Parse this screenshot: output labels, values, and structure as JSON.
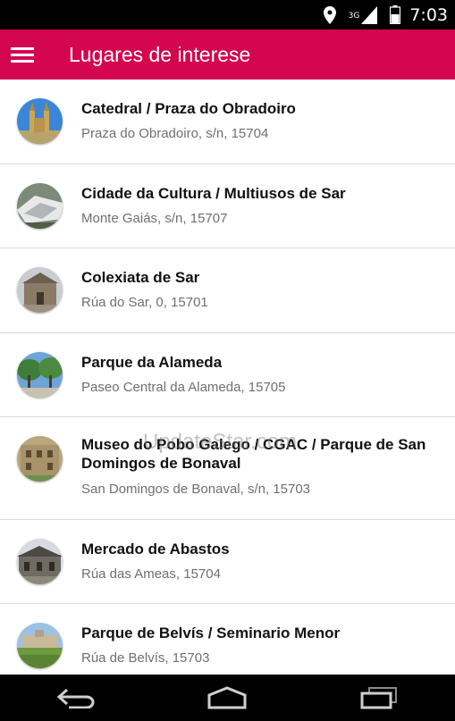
{
  "status_bar": {
    "network": "3G",
    "time": "7:03",
    "icons": [
      "location-icon",
      "signal-icon",
      "battery-icon"
    ]
  },
  "app_bar": {
    "title": "Lugares de interese",
    "menu_icon": "hamburger-menu-icon",
    "background": "#d3064f"
  },
  "places": [
    {
      "name": "Catedral / Praza do Obradoiro",
      "address": "Praza do Obradoiro, s/n, 15704"
    },
    {
      "name": "Cidade da Cultura / Multiusos de Sar",
      "address": "Monte Gaiás, s/n, 15707"
    },
    {
      "name": "Colexiata de Sar",
      "address": "Rúa do Sar, 0, 15701"
    },
    {
      "name": "Parque da Alameda",
      "address": "Paseo Central da Alameda, 15705"
    },
    {
      "name": "Museo do Pobo Galego / CGAC / Parque de San Domingos de Bonaval",
      "address": "San Domingos de Bonaval, s/n, 15703"
    },
    {
      "name": "Mercado de Abastos",
      "address": "Rúa das Ameas, 15704"
    },
    {
      "name": "Parque de Belvís / Seminario Menor",
      "address": "Rúa de Belvís, 15703"
    }
  ],
  "watermark": "UpdateStar.com",
  "nav_bar": {
    "icons": [
      "back-icon",
      "home-icon",
      "recent-apps-icon"
    ]
  }
}
